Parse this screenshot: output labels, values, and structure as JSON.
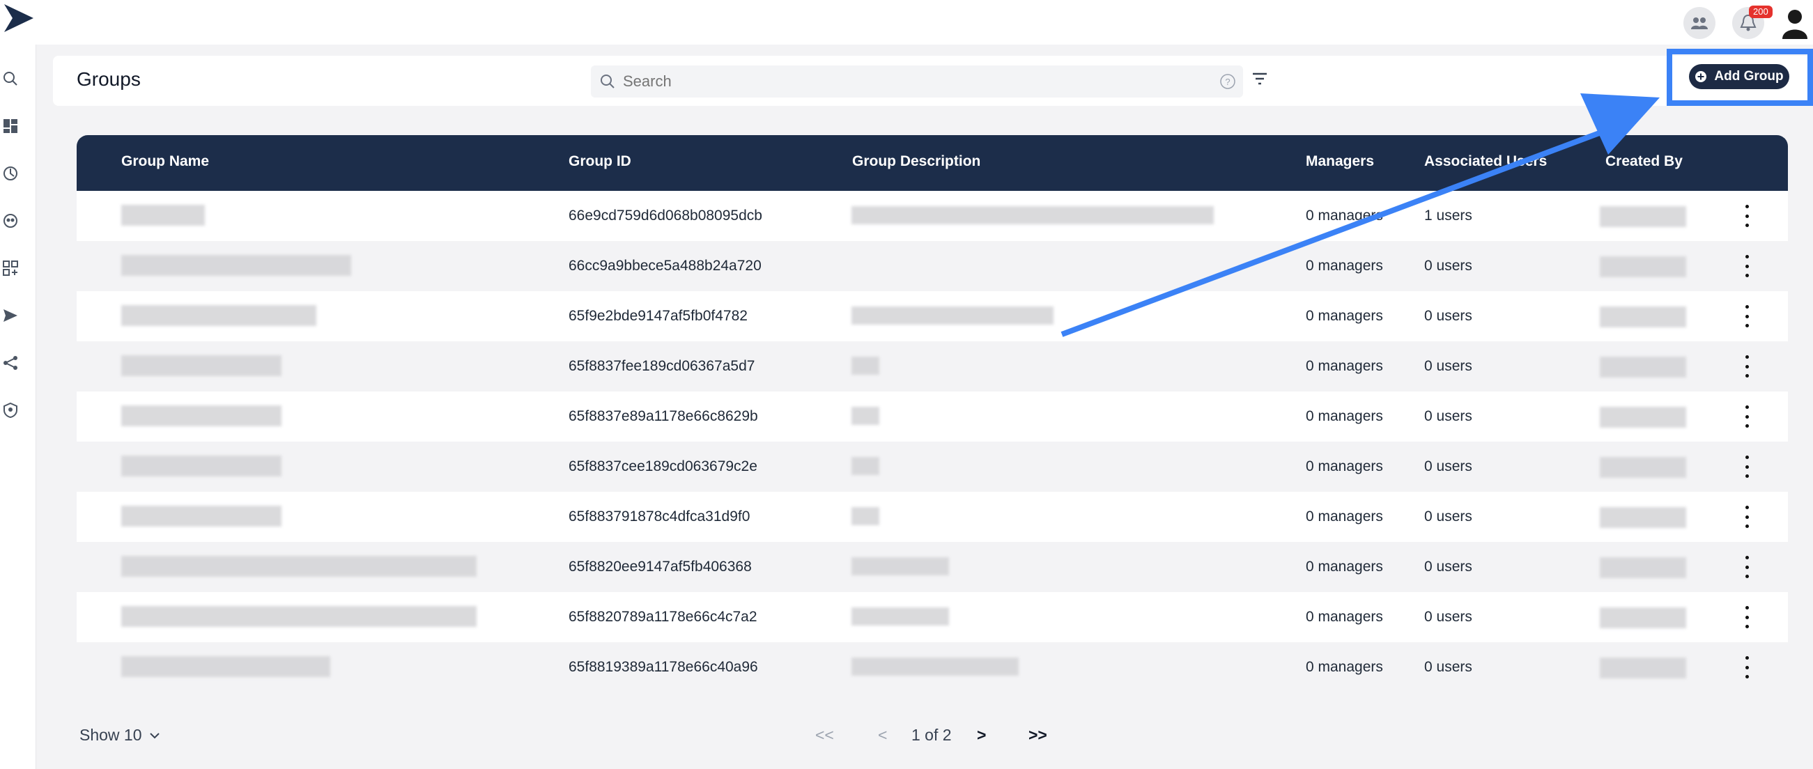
{
  "header": {
    "notification_count": "200"
  },
  "page": {
    "title": "Groups",
    "search_placeholder": "Search",
    "add_button_label": "Add Group"
  },
  "table": {
    "columns": {
      "name": "Group Name",
      "id": "Group ID",
      "description": "Group Description",
      "managers": "Managers",
      "users": "Associated Users",
      "created_by": "Created By"
    },
    "rows": [
      {
        "id": "66e9cd759d6d068b08095dcb",
        "managers": "0 managers",
        "users": "1 users"
      },
      {
        "id": "66cc9a9bbece5a488b24a720",
        "managers": "0 managers",
        "users": "0 users"
      },
      {
        "id": "65f9e2bde9147af5fb0f4782",
        "managers": "0 managers",
        "users": "0 users"
      },
      {
        "id": "65f8837fee189cd06367a5d7",
        "managers": "0 managers",
        "users": "0 users"
      },
      {
        "id": "65f8837e89a1178e66c8629b",
        "managers": "0 managers",
        "users": "0 users"
      },
      {
        "id": "65f8837cee189cd063679c2e",
        "managers": "0 managers",
        "users": "0 users"
      },
      {
        "id": "65f883791878c4dfca31d9f0",
        "managers": "0 managers",
        "users": "0 users"
      },
      {
        "id": "65f8820ee9147af5fb406368",
        "managers": "0 managers",
        "users": "0 users"
      },
      {
        "id": "65f8820789a1178e66c4c7a2",
        "managers": "0 managers",
        "users": "0 users"
      },
      {
        "id": "65f8819389a1178e66c40a96",
        "managers": "0 managers",
        "users": "0 users"
      }
    ]
  },
  "footer": {
    "show_label": "Show 10",
    "first": "<<",
    "prev": "<",
    "page_info": "1 of 2",
    "next": ">",
    "last": ">>"
  },
  "colors": {
    "table_header": "#1c2d4a",
    "highlight": "#3b82f6",
    "badge": "#e5322d"
  }
}
